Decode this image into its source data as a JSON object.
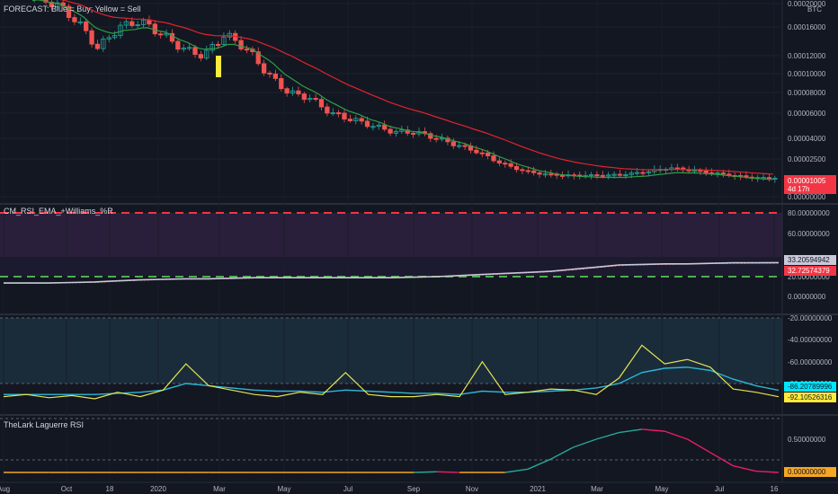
{
  "main_panel": {
    "legend": "FORECAST: Blue = Buy; Yellow = Sell",
    "currency": "BTC",
    "price_ticks": [
      "0.00020000",
      "0.00016000",
      "0.00012000",
      "0.00010000",
      "0.00008000",
      "0.00006000",
      "0.00004000",
      "0.00002500",
      "0.00001000",
      "0.00000000"
    ],
    "last_price": "0.00001005",
    "countdown": "4d 17h",
    "colors": {
      "up": "#26a69a",
      "down": "#ef5350",
      "ema_red": "#e0242c",
      "ema_green": "#2e9e46",
      "sell_marker": "#ffeb3b"
    }
  },
  "rsi_panel": {
    "title": "CM_RSI_EMA_+Williams_%R",
    "ticks": [
      "80.00000000",
      "60.00000000",
      "40.00000000",
      "20.00000000",
      "0.00000000"
    ],
    "rsi_value": "33.20594942",
    "ema_value": "32.72574379",
    "colors": {
      "overbought": "#f23645",
      "oversold": "#4caf50",
      "rsi": "#c8c8d8",
      "ema": "#ff5252"
    }
  },
  "williams_panel": {
    "ticks": [
      "-20.00000000",
      "-40.00000000",
      "-60.00000000",
      "-80.00000000"
    ],
    "williams_value": "-92.10526316",
    "ema_value": "-86.20789996",
    "colors": {
      "williams": "#e6e34f",
      "ema": "#2cb7d8"
    }
  },
  "laguerre_panel": {
    "title": "TheLark Laguerre RSI",
    "ticks": [
      "0.50000000",
      "0.00000000"
    ],
    "value": "0.00000000",
    "colors": {
      "line_low": "#f5a623",
      "rising": "#26a69a",
      "falling": "#e91e63"
    }
  },
  "time_axis": {
    "labels": [
      "Aug",
      "Oct",
      "18",
      "2020",
      "Mar",
      "May",
      "Jul",
      "Sep",
      "Nov",
      "2021",
      "Mar",
      "May",
      "Jul",
      "16"
    ]
  },
  "chart_data": [
    {
      "type": "candlestick",
      "title": "FORECAST: Blue = Buy; Yellow = Sell",
      "ylabel": "BTC",
      "ylim": [
        0,
        0.0002
      ],
      "y_scale": "log",
      "x_labels": [
        "Aug",
        "Oct",
        "18",
        "2020",
        "Mar",
        "May",
        "Jul",
        "Sep",
        "Nov",
        "2021",
        "Mar",
        "May",
        "Jul",
        "16"
      ],
      "close_approx": [
        0.00021,
        0.0002,
        0.00017,
        0.00013,
        0.00016,
        0.00017,
        0.00015,
        0.00013,
        0.00012,
        0.00015,
        0.00013,
        0.0001,
        8e-05,
        7.5e-05,
        6e-05,
        5.5e-05,
        5e-05,
        4.5e-05,
        4.5e-05,
        4e-05,
        3.5e-05,
        3e-05,
        2.2e-05,
        1.6e-05,
        1.3e-05,
        1.2e-05,
        1.2e-05,
        1.2e-05,
        1.3e-05,
        1.5e-05,
        1.8e-05,
        1.6e-05,
        1.4e-05,
        1.2e-05,
        1e-05,
        1.005e-05
      ],
      "last_price": 1.005e-05
    },
    {
      "type": "line",
      "title": "CM_RSI_EMA_+Williams_%R",
      "ylim": [
        0,
        85
      ],
      "levels": [
        80,
        20
      ],
      "series": [
        {
          "name": "RSI",
          "values": [
            14,
            14,
            14,
            14.5,
            15,
            16,
            17,
            17.5,
            18,
            18,
            18.5,
            19,
            19,
            19,
            19,
            19,
            19,
            19,
            19.5,
            20,
            21,
            22,
            23,
            24,
            25,
            27,
            29,
            31,
            31.5,
            32,
            32,
            32.5,
            33,
            33,
            33.2
          ]
        },
        {
          "name": "EMA",
          "values": [
            14,
            14,
            14,
            14.3,
            14.8,
            15.8,
            16.8,
            17.3,
            17.8,
            18,
            18.3,
            18.8,
            19,
            19,
            19,
            19,
            19,
            19,
            19.3,
            19.8,
            20.8,
            21.8,
            22.8,
            23.8,
            24.8,
            26.5,
            28.5,
            30.5,
            31.2,
            31.7,
            32,
            32.3,
            32.6,
            32.7,
            32.73
          ]
        }
      ]
    },
    {
      "type": "line",
      "ylim": [
        -100,
        -10
      ],
      "levels": [
        -20,
        -80
      ],
      "series": [
        {
          "name": "Williams %R",
          "values": [
            -92,
            -90,
            -93,
            -91,
            -94,
            -88,
            -92,
            -86,
            -62,
            -82,
            -86,
            -90,
            -92,
            -88,
            -90,
            -70,
            -90,
            -92,
            -92,
            -90,
            -92,
            -60,
            -90,
            -88,
            -85,
            -86,
            -90,
            -75,
            -45,
            -62,
            -58,
            -65,
            -85,
            -88,
            -92.1
          ]
        },
        {
          "name": "EMA",
          "values": [
            -90,
            -90,
            -90,
            -90,
            -90,
            -89,
            -88,
            -86,
            -80,
            -82,
            -84,
            -86,
            -87,
            -87,
            -88,
            -86,
            -87,
            -88,
            -89,
            -89,
            -90,
            -87,
            -88,
            -88,
            -87,
            -86,
            -84,
            -80,
            -70,
            -66,
            -65,
            -68,
            -76,
            -82,
            -86.2
          ]
        }
      ]
    },
    {
      "type": "line",
      "title": "TheLark Laguerre RSI",
      "ylim": [
        0,
        0.7
      ],
      "series": [
        {
          "name": "Laguerre RSI",
          "values": [
            0,
            0,
            0,
            0,
            0,
            0,
            0,
            0,
            0,
            0,
            0,
            0,
            0,
            0,
            0,
            0,
            0,
            0,
            0,
            0.01,
            0,
            0,
            0,
            0.05,
            0.2,
            0.38,
            0.5,
            0.6,
            0.65,
            0.62,
            0.5,
            0.3,
            0.1,
            0.02,
            0
          ]
        }
      ]
    }
  ]
}
